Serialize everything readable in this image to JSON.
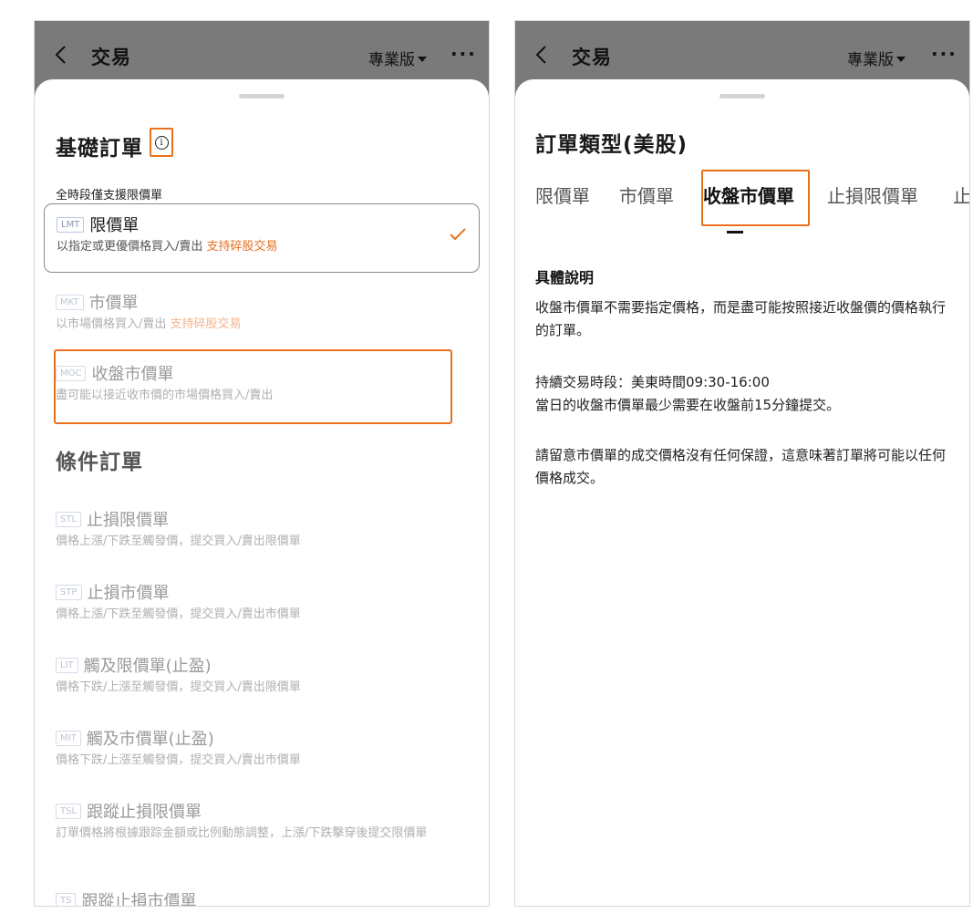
{
  "header": {
    "title": "交易",
    "edition": "專業版",
    "more": "···"
  },
  "left": {
    "basic_title": "基礎訂單",
    "info_icon": "i",
    "sub_label": "全時段僅支援限價單",
    "basic_orders": [
      {
        "tag": "LMT",
        "name": "限價單",
        "desc": "以指定或更優價格買入/賣出",
        "fractional": "支持碎股交易",
        "selected": true
      },
      {
        "tag": "MKT",
        "name": "市價單",
        "desc": "以市場價格買入/賣出",
        "fractional": "支持碎股交易",
        "selected": false
      },
      {
        "tag": "MOC",
        "name": "收盤市價單",
        "desc": "盡可能以接近收市價的市場價格買入/賣出",
        "fractional": "",
        "selected": false
      }
    ],
    "cond_title": "條件訂單",
    "cond_orders": [
      {
        "tag": "STL",
        "name": "止損限價單",
        "desc": "價格上漲/下跌至觸發價，提交買入/賣出限價單"
      },
      {
        "tag": "STP",
        "name": "止損市價單",
        "desc": "價格上漲/下跌至觸發價，提交買入/賣出市價單"
      },
      {
        "tag": "LIT",
        "name": "觸及限價單(止盈)",
        "desc": "價格下跌/上漲至觸發價，提交買入/賣出限價單"
      },
      {
        "tag": "MIT",
        "name": "觸及市價單(止盈)",
        "desc": "價格下跌/上漲至觸發價，提交買入/賣出市價單"
      },
      {
        "tag": "TSL",
        "name": "跟蹤止損限價單",
        "desc": "訂單價格將根據跟踪金額或比例動態調整，上漲/下跌擊穿後提交限價單"
      },
      {
        "tag": "TS",
        "name": "跟蹤止損市價單",
        "desc": ""
      }
    ]
  },
  "right": {
    "title": "訂單類型(美股)",
    "tabs": [
      "限價單",
      "市價單",
      "收盤市價單",
      "止損限價單",
      "止"
    ],
    "active_tab": 2,
    "detail_title": "具體說明",
    "paragraphs": [
      "收盤市價單不需要指定價格，而是盡可能按照接近收盤價的價格執行的訂單。",
      "持續交易時段：美東時間09:30-16:00\n當日的收盤市價單最少需要在收盤前15分鐘提交。",
      "請留意市價單的成交價格沒有任何保證，這意味著訂單將可能以任何價格成交。"
    ]
  },
  "colors": {
    "accent": "#e8701d",
    "header_bg": "#7a7a7a",
    "tag_border": "#b9c4dd"
  }
}
